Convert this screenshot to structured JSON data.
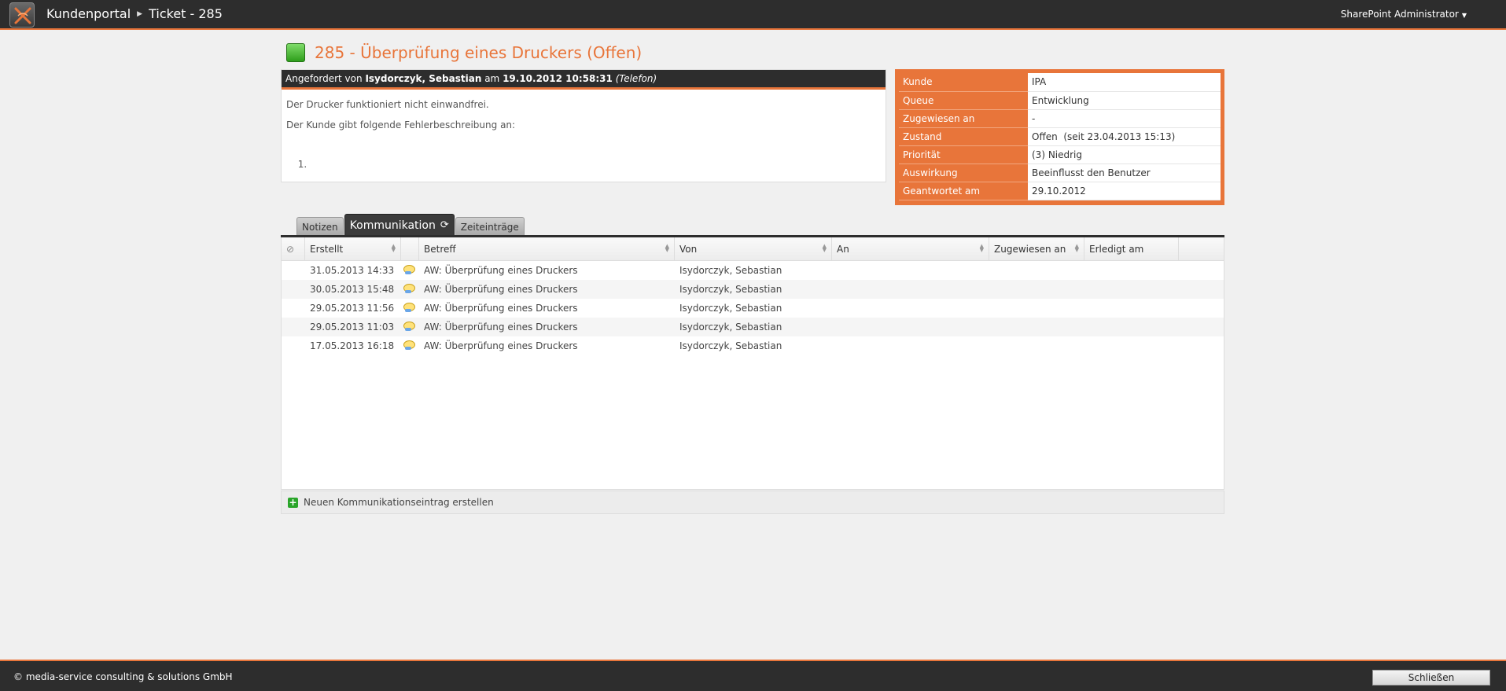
{
  "header": {
    "breadcrumb": [
      "Kundenportal",
      "Ticket - 285"
    ],
    "user": "SharePoint Administrator"
  },
  "ticket": {
    "title": "285 - Überprüfung eines Druckers (Offen)",
    "requested_prefix": "Angefordert von",
    "requester": "Isydorczyk, Sebastian",
    "on_word": "am",
    "requested_at": "19.10.2012 10:58:31",
    "channel": "(Telefon)",
    "description_line1": "Der Drucker funktioniert nicht einwandfrei.",
    "description_line2": "Der Kunde gibt folgende Fehlerbeschreibung an:",
    "description_list_item": ""
  },
  "info": [
    {
      "label": "Kunde",
      "value": "IPA"
    },
    {
      "label": "Queue",
      "value": "Entwicklung"
    },
    {
      "label": "Zugewiesen an",
      "value": "-"
    },
    {
      "label": "Zustand",
      "value": "Offen  (seit 23.04.2013 15:13)"
    },
    {
      "label": "Priorität",
      "value": "(3) Niedrig"
    },
    {
      "label": "Auswirkung",
      "value": "Beeinflusst den Benutzer"
    },
    {
      "label": "Geantwortet am",
      "value": "29.10.2012"
    }
  ],
  "tabs": [
    "Notizen",
    "Kommunikation",
    "Zeiteinträge"
  ],
  "grid": {
    "columns": [
      "Erstellt",
      "Betreff",
      "Von",
      "An",
      "Zugewiesen an",
      "Erledigt am"
    ],
    "rows": [
      {
        "created": "31.05.2013 14:33",
        "subject": "AW: Überprüfung eines Druckers",
        "from": "Isydorczyk, Sebastian"
      },
      {
        "created": "30.05.2013 15:48",
        "subject": "AW: Überprüfung eines Druckers",
        "from": "Isydorczyk, Sebastian"
      },
      {
        "created": "29.05.2013 11:56",
        "subject": "AW: Überprüfung eines Druckers",
        "from": "Isydorczyk, Sebastian"
      },
      {
        "created": "29.05.2013 11:03",
        "subject": "AW: Überprüfung eines Druckers",
        "from": "Isydorczyk, Sebastian"
      },
      {
        "created": "17.05.2013 16:18",
        "subject": "AW: Überprüfung eines Druckers",
        "from": "Isydorczyk, Sebastian"
      }
    ],
    "new_entry_label": "Neuen Kommunikationseintrag erstellen"
  },
  "footer": {
    "copyright": "© media-service consulting & solutions GmbH",
    "close_label": "Schließen"
  },
  "colors": {
    "accent": "#e8753a",
    "bar": "#2d2d2d",
    "status": "#2e9e1b"
  }
}
